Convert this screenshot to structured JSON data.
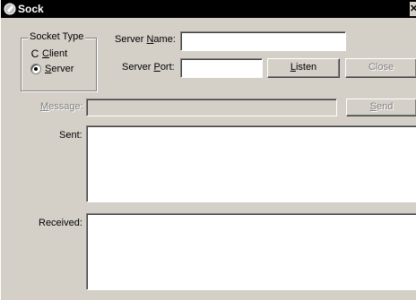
{
  "window": {
    "title": "Sock"
  },
  "socket_type": {
    "legend": "Socket Type",
    "options": [
      {
        "label": "Client",
        "accel": "C",
        "selected": false
      },
      {
        "label": "Server",
        "accel": "S",
        "selected": true
      }
    ]
  },
  "server_name": {
    "label_pre": "Server ",
    "label_accel": "N",
    "label_post": "ame:",
    "value": ""
  },
  "server_port": {
    "label_pre": "Server ",
    "label_accel": "P",
    "label_post": "ort:",
    "value": ""
  },
  "buttons": {
    "listen": {
      "accel": "L",
      "rest": "isten"
    },
    "close": "Close",
    "send": {
      "accel": "S",
      "rest": "end"
    }
  },
  "message": {
    "accel": "M",
    "rest": "essage:",
    "value": ""
  },
  "sent": {
    "label": "Sent:",
    "value": ""
  },
  "received": {
    "label": "Received:",
    "value": ""
  }
}
